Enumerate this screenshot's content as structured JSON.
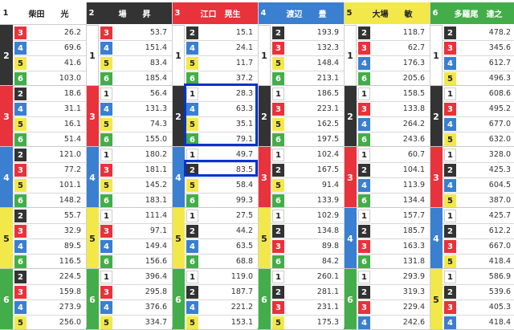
{
  "colors": {
    "1": {
      "bg": "#ffffff",
      "fg": "#222222"
    },
    "2": {
      "bg": "#333333",
      "fg": "#ffffff"
    },
    "3": {
      "bg": "#e8323c",
      "fg": "#ffffff"
    },
    "4": {
      "bg": "#3a7fd0",
      "fg": "#ffffff"
    },
    "5": {
      "bg": "#f2e84a",
      "fg": "#222222"
    },
    "6": {
      "bg": "#43ad4a",
      "fg": "#ffffff"
    }
  },
  "highlight_color": "#0033cc",
  "racers": [
    {
      "num": "1",
      "name": "柴田　　光",
      "groups": [
        {
          "first": "2",
          "rows": [
            {
              "sec": "3",
              "val": "26.2"
            },
            {
              "sec": "4",
              "val": "69.6"
            },
            {
              "sec": "5",
              "val": "41.6"
            },
            {
              "sec": "6",
              "val": "103.0"
            }
          ]
        },
        {
          "first": "3",
          "rows": [
            {
              "sec": "2",
              "val": "18.6"
            },
            {
              "sec": "4",
              "val": "31.1"
            },
            {
              "sec": "5",
              "val": "16.1"
            },
            {
              "sec": "6",
              "val": "51.4"
            }
          ]
        },
        {
          "first": "4",
          "rows": [
            {
              "sec": "2",
              "val": "121.0"
            },
            {
              "sec": "3",
              "val": "77.2"
            },
            {
              "sec": "5",
              "val": "101.1"
            },
            {
              "sec": "6",
              "val": "148.2"
            }
          ]
        },
        {
          "first": "5",
          "rows": [
            {
              "sec": "2",
              "val": "55.7"
            },
            {
              "sec": "3",
              "val": "32.9"
            },
            {
              "sec": "4",
              "val": "89.5"
            },
            {
              "sec": "6",
              "val": "116.5"
            }
          ]
        },
        {
          "first": "6",
          "rows": [
            {
              "sec": "2",
              "val": "224.5"
            },
            {
              "sec": "3",
              "val": "159.8"
            },
            {
              "sec": "4",
              "val": "273.9"
            },
            {
              "sec": "5",
              "val": "256.0"
            }
          ]
        }
      ]
    },
    {
      "num": "2",
      "name": "場　　昇",
      "groups": [
        {
          "first": "1",
          "rows": [
            {
              "sec": "3",
              "val": "53.7"
            },
            {
              "sec": "4",
              "val": "151.4"
            },
            {
              "sec": "5",
              "val": "83.4"
            },
            {
              "sec": "6",
              "val": "185.4"
            }
          ]
        },
        {
          "first": "3",
          "rows": [
            {
              "sec": "1",
              "val": "56.4"
            },
            {
              "sec": "4",
              "val": "131.3"
            },
            {
              "sec": "5",
              "val": "74.3"
            },
            {
              "sec": "6",
              "val": "155.0"
            }
          ]
        },
        {
          "first": "4",
          "rows": [
            {
              "sec": "1",
              "val": "180.2"
            },
            {
              "sec": "3",
              "val": "181.1"
            },
            {
              "sec": "5",
              "val": "145.2"
            },
            {
              "sec": "6",
              "val": "183.1"
            }
          ]
        },
        {
          "first": "5",
          "rows": [
            {
              "sec": "1",
              "val": "111.4"
            },
            {
              "sec": "3",
              "val": "97.1"
            },
            {
              "sec": "4",
              "val": "149.4"
            },
            {
              "sec": "6",
              "val": "156.6"
            }
          ]
        },
        {
          "first": "6",
          "rows": [
            {
              "sec": "1",
              "val": "396.4"
            },
            {
              "sec": "3",
              "val": "295.8"
            },
            {
              "sec": "4",
              "val": "376.6"
            },
            {
              "sec": "5",
              "val": "334.7"
            }
          ]
        }
      ]
    },
    {
      "num": "3",
      "name": "江口　晃生",
      "groups": [
        {
          "first": "1",
          "rows": [
            {
              "sec": "2",
              "val": "15.1"
            },
            {
              "sec": "4",
              "val": "24.1"
            },
            {
              "sec": "5",
              "val": "11.7"
            },
            {
              "sec": "6",
              "val": "37.2"
            }
          ]
        },
        {
          "first": "2",
          "rows": [
            {
              "sec": "1",
              "val": "28.3"
            },
            {
              "sec": "4",
              "val": "63.3"
            },
            {
              "sec": "5",
              "val": "35.1"
            },
            {
              "sec": "6",
              "val": "79.1"
            }
          ]
        },
        {
          "first": "4",
          "rows": [
            {
              "sec": "1",
              "val": "49.7"
            },
            {
              "sec": "2",
              "val": "83.5"
            },
            {
              "sec": "5",
              "val": "58.4"
            },
            {
              "sec": "6",
              "val": "99.3"
            }
          ]
        },
        {
          "first": "5",
          "rows": [
            {
              "sec": "1",
              "val": "27.5"
            },
            {
              "sec": "2",
              "val": "44.2"
            },
            {
              "sec": "4",
              "val": "63.5"
            },
            {
              "sec": "6",
              "val": "68.8"
            }
          ]
        },
        {
          "first": "6",
          "rows": [
            {
              "sec": "1",
              "val": "119.0"
            },
            {
              "sec": "2",
              "val": "187.7"
            },
            {
              "sec": "4",
              "val": "221.2"
            },
            {
              "sec": "5",
              "val": "153.1"
            }
          ]
        }
      ]
    },
    {
      "num": "4",
      "name": "渡辺　　豊",
      "groups": [
        {
          "first": "1",
          "rows": [
            {
              "sec": "2",
              "val": "193.9"
            },
            {
              "sec": "3",
              "val": "132.3"
            },
            {
              "sec": "5",
              "val": "148.4"
            },
            {
              "sec": "6",
              "val": "213.1"
            }
          ]
        },
        {
          "first": "2",
          "rows": [
            {
              "sec": "1",
              "val": "186.5"
            },
            {
              "sec": "3",
              "val": "223.1"
            },
            {
              "sec": "5",
              "val": "162.5"
            },
            {
              "sec": "6",
              "val": "197.5"
            }
          ]
        },
        {
          "first": "3",
          "rows": [
            {
              "sec": "1",
              "val": "102.4"
            },
            {
              "sec": "2",
              "val": "167.5"
            },
            {
              "sec": "5",
              "val": "91.4"
            },
            {
              "sec": "6",
              "val": "133.9"
            }
          ]
        },
        {
          "first": "5",
          "rows": [
            {
              "sec": "1",
              "val": "102.9"
            },
            {
              "sec": "2",
              "val": "134.8"
            },
            {
              "sec": "3",
              "val": "89.8"
            },
            {
              "sec": "6",
              "val": "84.2"
            }
          ]
        },
        {
          "first": "6",
          "rows": [
            {
              "sec": "1",
              "val": "260.1"
            },
            {
              "sec": "2",
              "val": "281.1"
            },
            {
              "sec": "3",
              "val": "231.1"
            },
            {
              "sec": "5",
              "val": "175.3"
            }
          ]
        }
      ]
    },
    {
      "num": "5",
      "name": "大場　　敏",
      "groups": [
        {
          "first": "1",
          "rows": [
            {
              "sec": "2",
              "val": "118.7"
            },
            {
              "sec": "3",
              "val": "62.7"
            },
            {
              "sec": "4",
              "val": "176.3"
            },
            {
              "sec": "6",
              "val": "205.6"
            }
          ]
        },
        {
          "first": "2",
          "rows": [
            {
              "sec": "1",
              "val": "158.5"
            },
            {
              "sec": "3",
              "val": "133.8"
            },
            {
              "sec": "4",
              "val": "264.2"
            },
            {
              "sec": "6",
              "val": "243.6"
            }
          ]
        },
        {
          "first": "3",
          "rows": [
            {
              "sec": "1",
              "val": "60.7"
            },
            {
              "sec": "2",
              "val": "104.1"
            },
            {
              "sec": "4",
              "val": "113.9"
            },
            {
              "sec": "6",
              "val": "134.4"
            }
          ]
        },
        {
          "first": "4",
          "rows": [
            {
              "sec": "1",
              "val": "157.7"
            },
            {
              "sec": "2",
              "val": "185.7"
            },
            {
              "sec": "3",
              "val": "163.3"
            },
            {
              "sec": "6",
              "val": "131.8"
            }
          ]
        },
        {
          "first": "6",
          "rows": [
            {
              "sec": "1",
              "val": "293.9"
            },
            {
              "sec": "2",
              "val": "319.3"
            },
            {
              "sec": "3",
              "val": "229.4"
            },
            {
              "sec": "4",
              "val": "242.6"
            }
          ]
        }
      ]
    },
    {
      "num": "6",
      "name": "多羅尾　達之",
      "groups": [
        {
          "first": "1",
          "rows": [
            {
              "sec": "2",
              "val": "478.2"
            },
            {
              "sec": "3",
              "val": "345.6"
            },
            {
              "sec": "4",
              "val": "612.7"
            },
            {
              "sec": "5",
              "val": "496.3"
            }
          ]
        },
        {
          "first": "2",
          "rows": [
            {
              "sec": "1",
              "val": "608.6"
            },
            {
              "sec": "3",
              "val": "495.2"
            },
            {
              "sec": "4",
              "val": "677.0"
            },
            {
              "sec": "5",
              "val": "632.0"
            }
          ]
        },
        {
          "first": "3",
          "rows": [
            {
              "sec": "1",
              "val": "328.0"
            },
            {
              "sec": "2",
              "val": "425.3"
            },
            {
              "sec": "4",
              "val": "604.5"
            },
            {
              "sec": "5",
              "val": "387.0"
            }
          ]
        },
        {
          "first": "4",
          "rows": [
            {
              "sec": "1",
              "val": "425.7"
            },
            {
              "sec": "2",
              "val": "612.2"
            },
            {
              "sec": "3",
              "val": "667.0"
            },
            {
              "sec": "5",
              "val": "418.4"
            }
          ]
        },
        {
          "first": "5",
          "rows": [
            {
              "sec": "1",
              "val": "586.9"
            },
            {
              "sec": "2",
              "val": "539.6"
            },
            {
              "sec": "3",
              "val": "405.3"
            },
            {
              "sec": "4",
              "val": "418.4"
            }
          ]
        }
      ]
    }
  ]
}
